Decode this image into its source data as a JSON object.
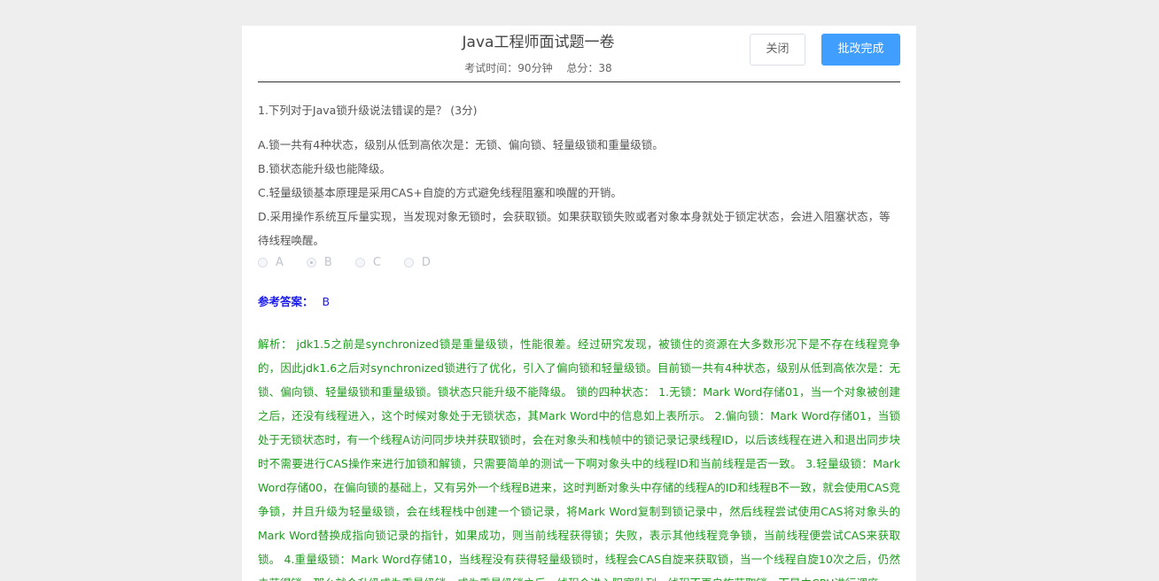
{
  "exam": {
    "title": "Java工程师面试题一卷",
    "duration": "考试时间：90分钟",
    "total": "总分：38"
  },
  "buttons": {
    "close": "关闭",
    "done": "批改完成"
  },
  "question": {
    "text": "1.下列对于Java锁升级说法错误的是？ (3分)",
    "options": [
      "A.锁一共有4种状态，级别从低到高依次是：无锁、偏向锁、轻量级锁和重量级锁。",
      "B.锁状态能升级也能降级。",
      "C.轻量级锁基本原理是采用CAS+自旋的方式避免线程阻塞和唤醒的开销。",
      "D.采用操作系统互斥量实现，当发现对象无锁时，会获取锁。如果获取锁失败或者对象本身就处于锁定状态，会进入阻塞状态，等待线程唤醒。"
    ],
    "choices": [
      "A",
      "B",
      "C",
      "D"
    ],
    "selected": "B"
  },
  "answer": {
    "label": "参考答案：",
    "value": "B"
  },
  "analysis": {
    "text": "解析： jdk1.5之前是synchronized锁是重量级锁，性能很差。经过研究发现，被锁住的资源在大多数形况下是不存在线程竞争的，因此jdk1.6之后对synchronized锁进行了优化，引入了偏向锁和轻量级锁。目前锁一共有4种状态，级别从低到高依次是：无锁、偏向锁、轻量级锁和重量级锁。锁状态只能升级不能降级。 锁的四种状态： 1.无锁：Mark Word存储01，当一个对象被创建之后，还没有线程进入，这个时候对象处于无锁状态，其Mark Word中的信息如上表所示。 2.偏向锁：Mark Word存储01，当锁处于无锁状态时，有一个线程A访问同步块并获取锁时，会在对象头和栈帧中的锁记录记录线程ID，以后该线程在进入和退出同步块时不需要进行CAS操作来进行加锁和解锁，只需要简单的测试一下啊对象头中的线程ID和当前线程是否一致。 3.轻量级锁：Mark Word存储00，在偏向锁的基础上，又有另外一个线程B进来，这时判断对象头中存储的线程A的ID和线程B不一致，就会使用CAS竞争锁，并且升级为轻量级锁，会在线程栈中创建一个锁记录，将Mark Word复制到锁记录中，然后线程尝试使用CAS将对象头的Mark Word替换成指向锁记录的指针，如果成功，则当前线程获得锁；失败，表示其他线程竞争锁，当前线程便尝试CAS来获取锁。 4.重量级锁：Mark Word存储10，当线程没有获得轻量级锁时，线程会CAS自旋来获取锁，当一个线程自旋10次之后，仍然未获得锁，那么就会升级成为重量级锁。成为重量级锁之后，线程会进入阻塞队列，线程不再自旋获取锁，而是由CPU进行调度"
  }
}
